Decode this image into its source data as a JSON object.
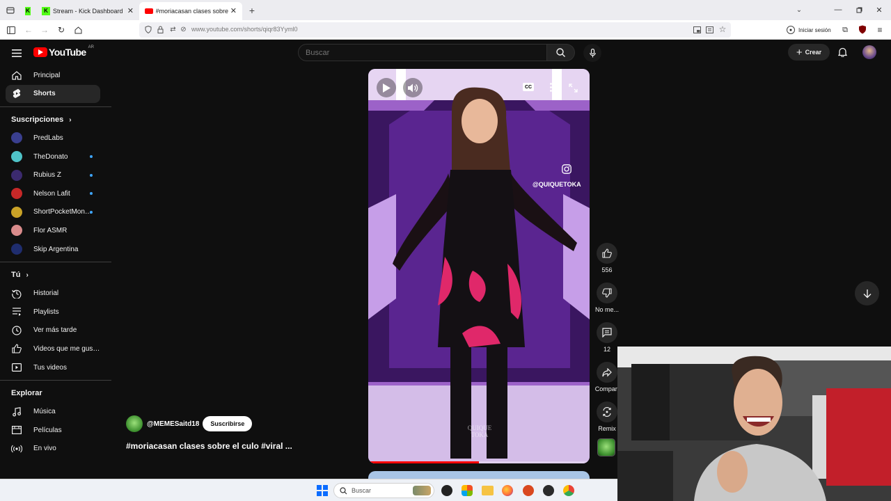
{
  "browser": {
    "tabs": [
      {
        "title": "Stream - Kick Dashboard",
        "active": false
      },
      {
        "title": "#moriacasan clases sobre el cul",
        "active": true
      }
    ],
    "url": "www.youtube.com/shorts/qiqr83Yyml0",
    "signin_label": "Iniciar sesión"
  },
  "youtube": {
    "logo_text": "YouTube",
    "logo_region": "AR",
    "search_placeholder": "Buscar",
    "create_label": "Crear",
    "sidebar": {
      "main": [
        {
          "label": "Principal",
          "icon": "home-icon"
        },
        {
          "label": "Shorts",
          "icon": "shorts-icon",
          "active": true
        }
      ],
      "subscriptions_title": "Suscripciones",
      "subscriptions": [
        {
          "label": "PredLabs",
          "color": "#3a3f8f",
          "dot": false
        },
        {
          "label": "TheDonato",
          "color": "#4fc3c8",
          "dot": true
        },
        {
          "label": "Rubius Z",
          "color": "#3b2a6e",
          "dot": true
        },
        {
          "label": "Nelson Lafit",
          "color": "#c62828",
          "dot": true
        },
        {
          "label": "ShortPocketMon…",
          "color": "#c9a227",
          "dot": true
        },
        {
          "label": "Flor ASMR",
          "color": "#d98b8b",
          "dot": false
        },
        {
          "label": "Skip Argentina",
          "color": "#1f2d6e",
          "dot": false
        }
      ],
      "you_title": "Tú",
      "you": [
        {
          "label": "Historial",
          "icon": "history-icon"
        },
        {
          "label": "Playlists",
          "icon": "playlists-icon"
        },
        {
          "label": "Ver más tarde",
          "icon": "clock-icon"
        },
        {
          "label": "Videos que me gus…",
          "icon": "thumb-up-icon"
        },
        {
          "label": "Tus videos",
          "icon": "play-square-icon"
        }
      ],
      "explore_title": "Explorar",
      "explore": [
        {
          "label": "Música",
          "icon": "music-icon"
        },
        {
          "label": "Películas",
          "icon": "film-icon"
        },
        {
          "label": "En vivo",
          "icon": "live-icon"
        }
      ]
    },
    "short": {
      "channel": "@MEMESaitd18",
      "subscribe_label": "Suscribirse",
      "title": "#moriacasan clases sobre el culo #viral ...",
      "watermark": "@QUIQUETOKA",
      "watermark_bottom": "QUIQUE TOKA",
      "progress": 0.5,
      "cc_label": "CC"
    },
    "actions": {
      "like_count": "556",
      "dislike_label": "No me...",
      "comments_count": "12",
      "share_label": "Compart",
      "remix_label": "Remix"
    }
  },
  "taskbar": {
    "search_placeholder": "Buscar"
  }
}
